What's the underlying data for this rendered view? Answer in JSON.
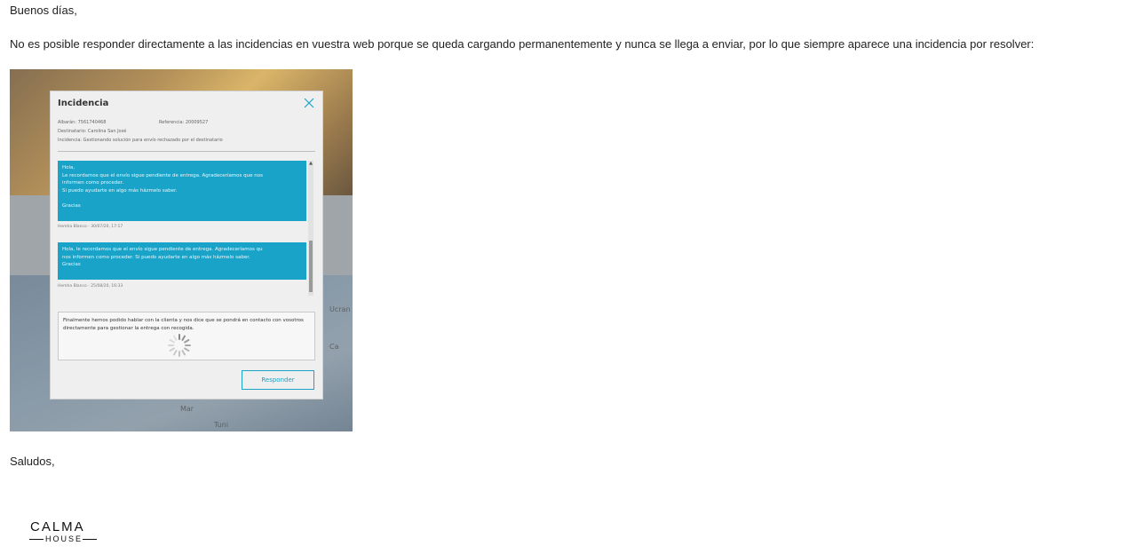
{
  "email": {
    "greeting": "Buenos días,",
    "body": "No es posible responder directamente a las incidencias en vuestra web porque se queda cargando permanentemente y nunca se llega a enviar, por lo que siempre aparece una incidencia por resolver:",
    "closing": "Saludos,"
  },
  "screenshot": {
    "map_labels": [
      "Ucran",
      "Ca",
      "Mar",
      "Tuni"
    ],
    "modal": {
      "title": "Incidencia",
      "albaran": "Albarán: 7561740468",
      "referencia": "Referencia: 20009527",
      "destinatario": "Destinatario: Carolina San José",
      "incidencia": "Incidencia: Gestionando solución para envío rechazado por el destinatario",
      "messages": [
        {
          "lines": [
            "Hola,",
            "Le recordamos que el envío sigue pendiente de entrega. Agradeceríamos que nos",
            "informen como proceder.",
            "Si puedo ayudarte en algo más házmelo saber.",
            "",
            "Gracias"
          ],
          "meta": "Hemha Blanco - 30/07/20, 17:17"
        },
        {
          "lines": [
            "Hola, le recordamos que el envío sigue pendiente de entrega. Agradeceríamos qu",
            "nos informen como proceder. Si puedo ayudarte en algo más házmelo saber.",
            "Gracias"
          ],
          "meta": "Hemha Blanco - 25/08/20, 16:33"
        }
      ],
      "reply_text": "Finalmente hemos podido hablar con la clienta y nos dice que se pondrá en contacto con vosotros directamente para gestionar la entrega con recogida.",
      "reply_button": "Responder",
      "scroll_up_glyph": "▲"
    },
    "colors": {
      "accent": "#1aa3c8"
    }
  },
  "signature": {
    "logo_top": "CALMA",
    "logo_bottom": "HOUSE"
  }
}
